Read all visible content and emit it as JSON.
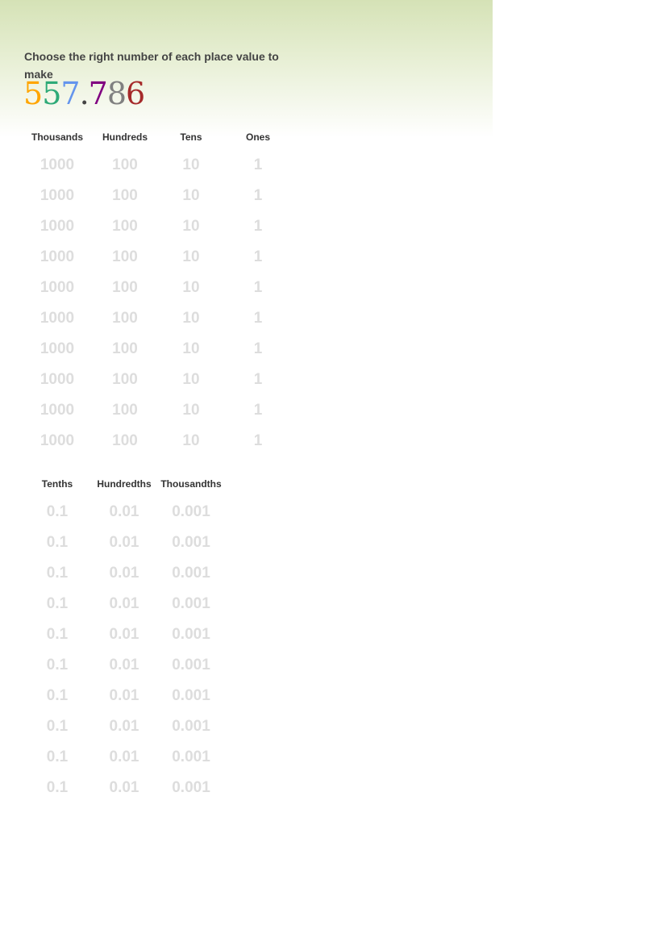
{
  "prompt": "Choose the right number of each place value to make",
  "target_digits": [
    {
      "char": "5",
      "color": "#FFA500"
    },
    {
      "char": "5",
      "color": "#2EAA78"
    },
    {
      "char": "7",
      "color": "#6495ED"
    },
    {
      "char": ".",
      "color": "#444444"
    },
    {
      "char": "7",
      "color": "#800080"
    },
    {
      "char": "8",
      "color": "#808080"
    },
    {
      "char": "6",
      "color": "#A52A2A"
    }
  ],
  "whole": {
    "headers": [
      "Thousands",
      "Hundreds",
      "Tens",
      "Ones"
    ],
    "values": [
      "1000",
      "100",
      "10",
      "1"
    ],
    "rows": 10
  },
  "decimal": {
    "headers": [
      "Tenths",
      "Hundredths",
      "Thousandths"
    ],
    "values": [
      "0.1",
      "0.01",
      "0.001"
    ],
    "rows": 10
  }
}
